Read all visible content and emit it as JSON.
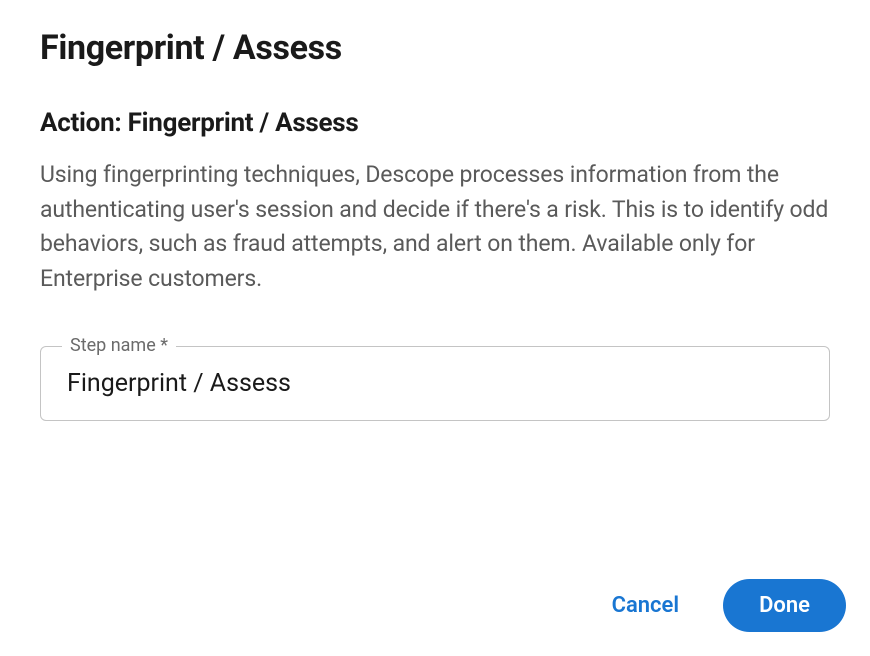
{
  "dialog": {
    "title": "Fingerprint / Assess",
    "subtitle": "Action: Fingerprint / Assess",
    "description": "Using fingerprinting techniques, Descope processes information from the authenticating user's session and decide if there's a risk. This is to identify odd behaviors, such as fraud attempts, and alert on them. Available only for Enterprise customers."
  },
  "form": {
    "step_name": {
      "label": "Step name *",
      "value": "Fingerprint / Assess"
    }
  },
  "actions": {
    "cancel_label": "Cancel",
    "done_label": "Done"
  }
}
